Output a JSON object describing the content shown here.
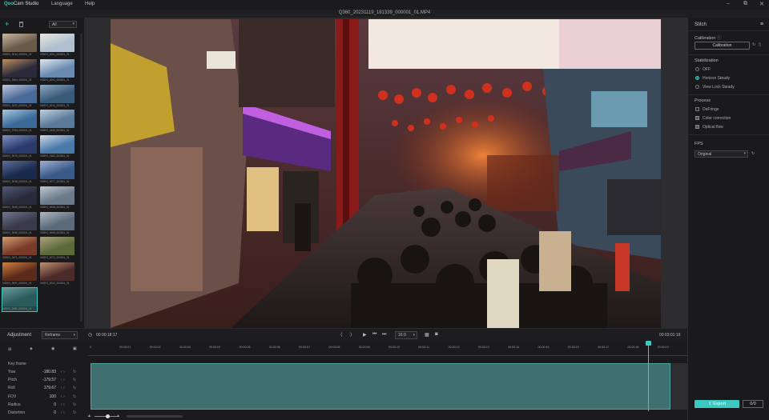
{
  "app": {
    "logo_brand": "Qoo",
    "logo_rest": "Cam Studio",
    "menus": [
      "Language",
      "Help"
    ],
    "window_title": "Q360_20231119_181339_000001_01.MP4",
    "win_controls": [
      "–",
      "⧉",
      "✕"
    ]
  },
  "media": {
    "filter": "All",
    "clips": [
      "VIDEO_0044_000001_01",
      "VIDEO_0031_000001_01",
      "VIDEO_0064_000001_01",
      "VIDEO_0042_000001_01",
      "VIDEO_0022_000001_01",
      "VIDEO_0014_000001_01",
      "VIDEO_0794_000001_01",
      "VIDEO_0449_000001_01",
      "VIDEO_0070_000001_01",
      "VIDEO_0182_000001_01",
      "VIDEO_0016_000001_01",
      "VIDEO_0077_000001_01",
      "VIDEO_0046_000001_01",
      "VIDEO_0008_000001_01",
      "VIDEO_0030_000001_01",
      "VIDEO_0049_000001_01",
      "VIDEO_0471_000001_01",
      "VIDEO_0072_000001_01",
      "VIDEO_0021_000001_01",
      "VIDEO_0012_000001_01",
      "VIDEO_0181_000001_01"
    ]
  },
  "right_panel": {
    "stitch": "Stitch",
    "calibration_label": "Calibration",
    "calibration_button": "Calibration",
    "stabilization_label": "Stabilization",
    "stab_options": [
      "OFF",
      "Horizon Steady",
      "View Lock Steady"
    ],
    "stab_selected": 1,
    "process_label": "Process",
    "process_options": [
      "DeFringe",
      "Color correction",
      "Optical flow"
    ],
    "process_checked": [
      false,
      true,
      true
    ],
    "fps_label": "FPS",
    "fps_value": "Original",
    "export_label": "Export",
    "export_count": "0/0"
  },
  "controls": {
    "adjustment": "Adjustment",
    "reframe": "Reframe",
    "current_time": "00:00:18:17",
    "speed": "16:9",
    "total_time": "00:03:01:19"
  },
  "timeline": {
    "keyframe_label": "Key frame",
    "params": [
      {
        "name": "Yaw",
        "value": "-180.83"
      },
      {
        "name": "Pitch",
        "value": "-179.57"
      },
      {
        "name": "Roll",
        "value": "179.67"
      },
      {
        "name": "FOV",
        "value": "100"
      },
      {
        "name": "Radius",
        "value": "0"
      },
      {
        "name": "Distortion",
        "value": "0"
      }
    ],
    "ticks": [
      "0",
      "00:00:01",
      "00:00:02",
      "00:00:03",
      "00:00:04",
      "00:00:05",
      "00:00:06",
      "00:00:07",
      "00:00:08",
      "00:00:09",
      "00:00:10",
      "00:00:11",
      "00:00:12",
      "00:00:13",
      "00:00:14",
      "00:00:15",
      "00:00:16",
      "00:00:17",
      "00:00:18",
      "00:00:19"
    ]
  }
}
